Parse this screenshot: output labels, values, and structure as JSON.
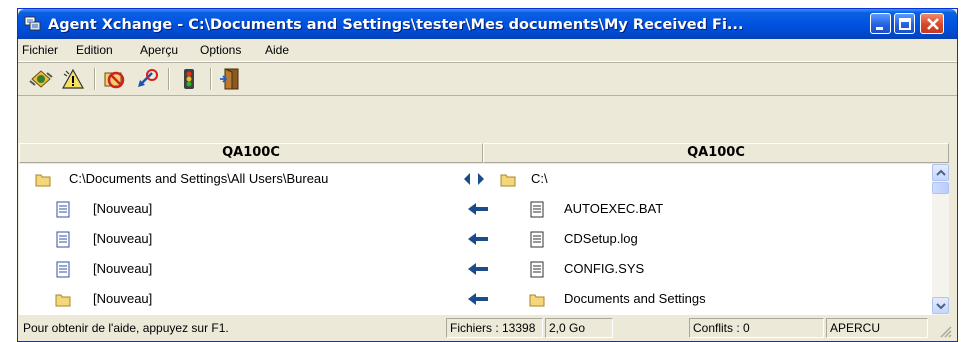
{
  "window": {
    "title": "Agent Xchange - C:\\Documents and Settings\\tester\\Mes documents\\My Received Fi...",
    "icon": "app-icon",
    "controls": [
      "minimize-icon",
      "maximize-icon",
      "close-icon"
    ]
  },
  "menu": {
    "items": [
      "Fichier",
      "Edition",
      "Aperçu",
      "Options",
      "Aide"
    ]
  },
  "toolbar": {
    "buttons": [
      "sync-icon",
      "warning-icon",
      "no-transfer-icon",
      "undo-arrow-icon",
      "traffic-light-icon",
      "exit-door-icon"
    ]
  },
  "columns": {
    "left": "QA100C",
    "right": "QA100C"
  },
  "rows": [
    {
      "left_icon": "folder-icon",
      "left": "C:\\Documents and Settings\\All Users\\Bureau",
      "direction": "both-arrows-icon",
      "right_icon": "folder-icon",
      "right": "C:\\"
    },
    {
      "left_icon": "document-icon",
      "left": "[Nouveau]",
      "direction": "left-arrow-icon",
      "right_icon": "document-icon",
      "right": "AUTOEXEC.BAT"
    },
    {
      "left_icon": "document-icon",
      "left": "[Nouveau]",
      "direction": "left-arrow-icon",
      "right_icon": "document-icon",
      "right": "CDSetup.log"
    },
    {
      "left_icon": "document-icon",
      "left": "[Nouveau]",
      "direction": "left-arrow-icon",
      "right_icon": "document-icon",
      "right": "CONFIG.SYS"
    },
    {
      "left_icon": "folder-icon",
      "left": "[Nouveau]",
      "direction": "left-arrow-icon",
      "right_icon": "folder-icon",
      "right": "Documents and Settings"
    }
  ],
  "status": {
    "help": "Pour obtenir de l'aide, appuyez sur F1.",
    "files": "Fichiers : 13398",
    "size": "2,0 Go",
    "conflicts": "Conflits : 0",
    "mode": "APERCU"
  },
  "colors": {
    "titlebar": "#0053e1",
    "arrow": "#1a4c8c",
    "window_bg": "#ece9d8"
  }
}
